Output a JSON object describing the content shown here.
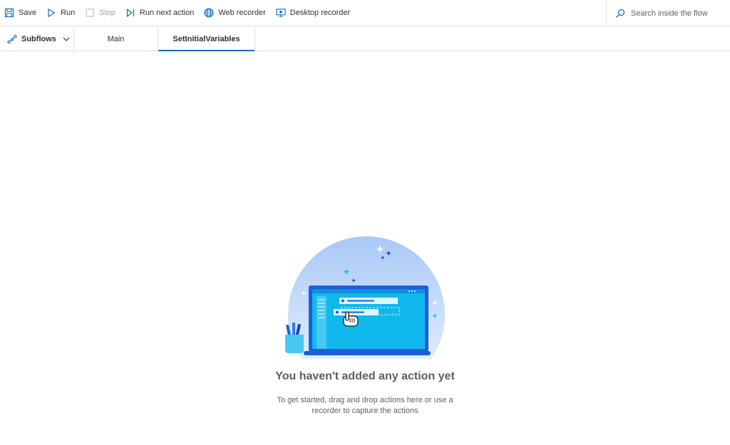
{
  "toolbar": {
    "save_label": "Save",
    "run_label": "Run",
    "stop_label": "Stop",
    "run_next_label": "Run next action",
    "web_recorder_label": "Web recorder",
    "desktop_recorder_label": "Desktop recorder"
  },
  "search": {
    "placeholder": "Search inside the flow"
  },
  "subflows": {
    "label": "Subflows"
  },
  "tabs": [
    {
      "label": "Main",
      "active": false
    },
    {
      "label": "SetInitialVariables",
      "active": true
    }
  ],
  "empty_state": {
    "title": "You haven't added any action yet",
    "line1": "To get started, drag and drop actions here or use a",
    "line2": "recorder to capture the actions"
  },
  "colors": {
    "accent": "#0f6cbd",
    "disabled": "#a19f9d",
    "border": "#e1dfdd"
  }
}
